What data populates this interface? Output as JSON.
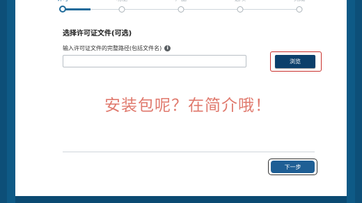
{
  "stepper": {
    "steps": [
      {
        "label": "许可"
      },
      {
        "label": "功能"
      },
      {
        "label": "产品"
      },
      {
        "label": "选项"
      },
      {
        "label": "完成"
      }
    ]
  },
  "license": {
    "section_title": "选择许可证文件(可选)",
    "path_label": "输入许可证文件的完整路径(包括文件名)",
    "path_value": "",
    "info_symbol": "i",
    "browse_label": "浏览"
  },
  "annotation": {
    "text": "安装包呢？在简介哦！",
    "color": "#e07a6e"
  },
  "footer": {
    "next_label": "下一步"
  },
  "colors": {
    "accent": "#1f6b9b",
    "button_dark": "#0b3f6b",
    "background": "#0e5a86",
    "highlight_red": "#c9302c"
  }
}
